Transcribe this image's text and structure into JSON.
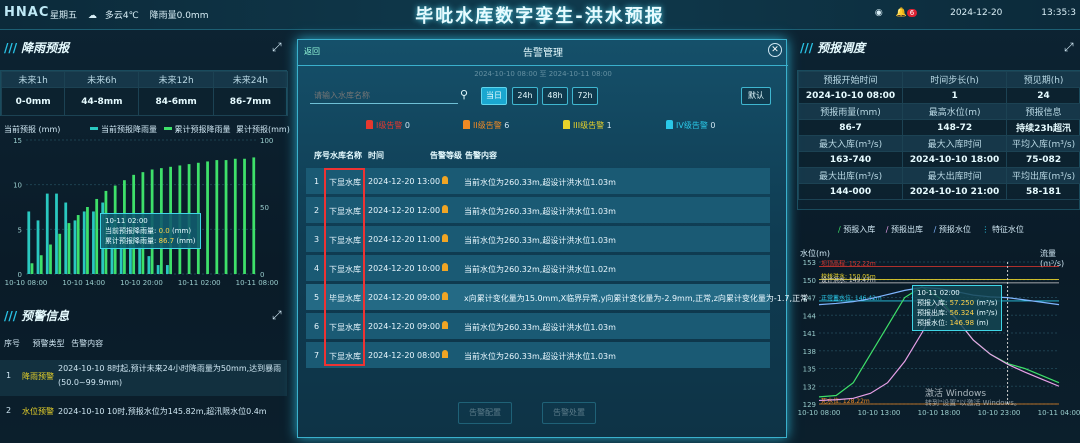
{
  "header": {
    "logo": "HNAC",
    "weekday": "星期五",
    "weather": "多云4℃",
    "rainfall": "降雨量0.0mm",
    "title": "毕吡水库数字孪生-洪水预报",
    "badge": "6",
    "date": "2024-12-20",
    "time": "13:35:3"
  },
  "rain_forecast": {
    "title": "降雨预报",
    "headers": [
      "未来1h",
      "未来6h",
      "未来12h",
      "未来24h"
    ],
    "values": [
      "0-0mm",
      "44-8mm",
      "84-6mm",
      "86-7mm"
    ],
    "ylabel_left": "当前预报 (mm)",
    "ylabel_right": "累计预报(mm)",
    "legend": [
      "当前预报降雨量",
      "累计预报降雨量"
    ],
    "tooltip": {
      "time": "10-11 02:00",
      "cur_label": "当前预报降雨量:",
      "cur_val": "0.0",
      "unit": "(mm)",
      "acc_label": "累计预报降雨量:",
      "acc_val": "86.7"
    }
  },
  "warning_info": {
    "title": "预警信息",
    "headers": [
      "序号",
      "预警类型",
      "告警内容"
    ],
    "rows": [
      {
        "no": "1",
        "type": "降雨预警",
        "content": "2024-10-10 8时起,预计未来24小时降雨量为50mm,达到暴雨(50.0~99.9mm)"
      },
      {
        "no": "2",
        "type": "水位预警",
        "content": "2024-10-10 10时,预报水位为145.82m,超汛限水位0.4m"
      }
    ]
  },
  "modal": {
    "title": "告警管理",
    "corner": "返回",
    "subtitle": "2024-10-10 08:00 至 2024-10-11 08:00",
    "search_placeholder": "请输入水库名称",
    "buttons": [
      "当日",
      "24h",
      "48h",
      "72h"
    ],
    "default_button": "默认",
    "levels": [
      {
        "label": "I级告警",
        "count": "0",
        "color": "#e5382f"
      },
      {
        "label": "II级告警",
        "count": "6",
        "color": "#f08a24"
      },
      {
        "label": "III级告警",
        "count": "1",
        "color": "#e8d22a"
      },
      {
        "label": "IV级告警",
        "count": "0",
        "color": "#2ac8e8"
      }
    ],
    "table_headers": [
      "序号",
      "水库名称",
      "时间",
      "告警等级",
      "告警内容"
    ],
    "rows": [
      {
        "no": "1",
        "name": "下显水库",
        "time": "2024-12-20 13:00",
        "content": "当前水位为260.33m,超设计洪水位1.03m"
      },
      {
        "no": "2",
        "name": "下显水库",
        "time": "2024-12-20 12:00",
        "content": "当前水位为260.33m,超设计洪水位1.03m"
      },
      {
        "no": "3",
        "name": "下显水库",
        "time": "2024-12-20 11:00",
        "content": "当前水位为260.33m,超设计洪水位1.03m"
      },
      {
        "no": "4",
        "name": "下显水库",
        "time": "2024-12-20 10:00",
        "content": "当前水位为260.32m,超设计洪水位1.02m"
      },
      {
        "no": "5",
        "name": "毕显水库",
        "time": "2024-12-20 09:00",
        "content": "x向累计变化量为15.0mm,X临界异常,y向累计变化量为-2.9mm,正常,z向累计变化量为-1.7,正常"
      },
      {
        "no": "6",
        "name": "下显水库",
        "time": "2024-12-20 09:00",
        "content": "当前水位为260.33m,超设计洪水位1.03m"
      },
      {
        "no": "7",
        "name": "下显水库",
        "time": "2024-12-20 08:00",
        "content": "当前水位为260.33m,超设计洪水位1.03m"
      }
    ],
    "footer_buttons": [
      "告警配置",
      "告警处置"
    ]
  },
  "dispatch": {
    "title": "预报调度",
    "r1h": [
      "预报开始时间",
      "时间步长(h)",
      "预见期(h)"
    ],
    "r1v": [
      "2024-10-10 08:00",
      "1",
      "24"
    ],
    "r2h": [
      "预报雨量(mm)",
      "最高水位(m)",
      "预报信息"
    ],
    "r2v": [
      "86-7",
      "148-72",
      "持续23h超汛"
    ],
    "r3h": [
      "最大入库(m³/s)",
      "最大入库时间",
      "平均入库(m³/s)"
    ],
    "r3v": [
      "163-740",
      "2024-10-10 18:00",
      "75-082"
    ],
    "r4h": [
      "最大出库(m³/s)",
      "最大出库时间",
      "平均出库(m³/s)"
    ],
    "r4v": [
      "144-000",
      "2024-10-10 21:00",
      "58-181"
    ],
    "legend": [
      "预报入库",
      "预报出库",
      "预报水位",
      "特征水位"
    ],
    "ylabel_left": "水位(m)",
    "ylabel_right": "流量(m³/s)",
    "lines": [
      {
        "label": "坝顶高程: 152.22m",
        "color": "#e5382f"
      },
      {
        "label": "校核洪水: 150.05m",
        "color": "#e8d22a"
      },
      {
        "label": "设计洪水: 149.47m",
        "color": "#d1d1d1"
      },
      {
        "label": "正常蓄水位: 146.42m",
        "color": "#2ac8e8"
      },
      {
        "label": "死水位: 128.22m",
        "color": "#f08a24"
      }
    ],
    "tooltip": {
      "time": "10-11 02:00",
      "in_label": "预报入库:",
      "in_val": "57.250",
      "out_label": "预报出库:",
      "out_val": "56.324",
      "unit": "(m³/s)",
      "lvl_label": "预报水位:",
      "lvl_val": "146.98",
      "lvl_unit": "(m)"
    },
    "watermark1": "激活 Windows",
    "watermark2": "转到\"设置\"以激活 Windows。"
  },
  "chart_data": [
    {
      "type": "bar",
      "title": "",
      "x": [
        "10-10 08:00",
        "10-10 14:00",
        "10-10 20:00",
        "10-11 02:00",
        "10-11 08:00"
      ],
      "series": [
        {
          "name": "当前预报降雨量",
          "values": [
            7,
            6,
            9,
            9,
            8,
            6,
            7,
            7,
            8,
            6,
            5,
            4,
            3,
            2,
            1,
            1,
            0,
            0,
            0,
            0,
            0,
            0,
            0,
            0,
            0
          ]
        },
        {
          "name": "累计预报降雨量",
          "values": [
            8,
            14,
            22,
            30,
            38,
            44,
            50,
            56,
            62,
            66,
            70,
            74,
            76,
            78,
            79,
            80,
            81,
            82,
            83,
            84,
            85,
            85,
            86,
            86,
            87
          ]
        }
      ],
      "ylim_left": [
        0,
        15
      ],
      "ylim_right": [
        0,
        100
      ],
      "yticks_left": [
        0,
        5,
        10,
        15
      ],
      "yticks_right": [
        0,
        50,
        100
      ]
    },
    {
      "type": "line",
      "title": "",
      "x": [
        "10-10 08:00",
        "10-10 13:00",
        "10-10 18:00",
        "10-10 23:00",
        "10-11 04:00"
      ],
      "series": [
        {
          "name": "预报入库",
          "values": [
            10,
            12,
            30,
            70,
            110,
            150,
            165,
            150,
            120,
            90,
            70,
            57,
            50,
            40,
            30
          ]
        },
        {
          "name": "预报出库",
          "values": [
            5,
            6,
            8,
            15,
            30,
            60,
            100,
            144,
            120,
            90,
            70,
            56,
            45,
            35,
            25
          ]
        },
        {
          "name": "预报水位",
          "values": [
            145.8,
            146.0,
            146.3,
            146.8,
            147.5,
            148.2,
            148.7,
            148.5,
            148.0,
            147.4,
            147.1,
            146.98,
            146.6,
            146.2,
            145.8
          ]
        }
      ],
      "ylim_left": [
        129,
        153
      ],
      "yticks_left": [
        129,
        132,
        135,
        138,
        141,
        144,
        147,
        150,
        153
      ]
    }
  ]
}
